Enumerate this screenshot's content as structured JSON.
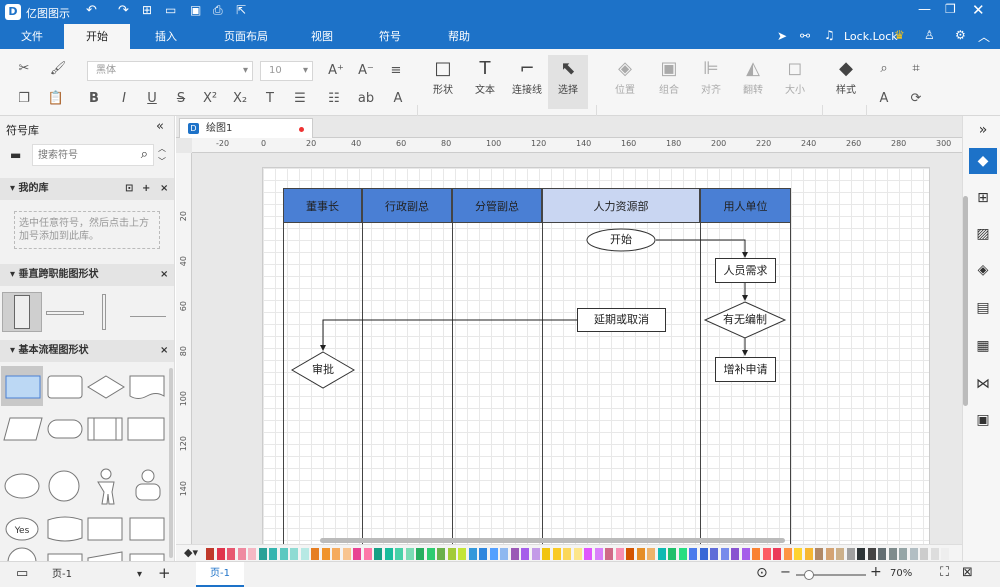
{
  "app": {
    "title": "亿图图示",
    "user": "Lock.Lock"
  },
  "menu": [
    "文件",
    "开始",
    "插入",
    "页面布局",
    "视图",
    "符号",
    "帮助"
  ],
  "ribbon": {
    "font_name": "黑体",
    "font_size": "10",
    "tools": [
      {
        "label": "形状"
      },
      {
        "label": "文本"
      },
      {
        "label": "连接线"
      },
      {
        "label": "选择"
      }
    ],
    "arrange": [
      {
        "label": "位置"
      },
      {
        "label": "组合"
      },
      {
        "label": "对齐"
      },
      {
        "label": "翻转"
      },
      {
        "label": "大小"
      }
    ],
    "style_label": "样式"
  },
  "sidebar": {
    "title": "符号库",
    "search_placeholder": "搜索符号",
    "sections": [
      "我的库",
      "垂直跨职能图形状",
      "基本流程图形状"
    ],
    "mylib_hint": "选中任意符号，然后点击上方加号添加到此库。",
    "shape_labels": {
      "yes": "Yes"
    }
  },
  "document": {
    "tab": "绘图1"
  },
  "ruler": {
    "h": [
      "-20",
      "0",
      "20",
      "40",
      "60",
      "80",
      "100",
      "120",
      "140",
      "160",
      "180",
      "200",
      "220",
      "240",
      "260",
      "280",
      "300"
    ],
    "v": [
      "20",
      "40",
      "60",
      "80",
      "100",
      "120",
      "140"
    ]
  },
  "diagram": {
    "lanes": [
      "董事长",
      "行政副总",
      "分管副总",
      "人力资源部",
      "用人单位"
    ],
    "nodes": {
      "start": "开始",
      "need": "人员需求",
      "decide": "有无编制",
      "delay": "延期或取消",
      "approve": "审批",
      "supplement": "增补申请"
    }
  },
  "colors": {
    "accent": "#1d72c8",
    "lane_header": "#4a7fd4",
    "lane_header_light": "#c9d6f2"
  },
  "statusbar": {
    "page_select": "页-1",
    "page_tab": "页-1",
    "zoom": "70%"
  }
}
